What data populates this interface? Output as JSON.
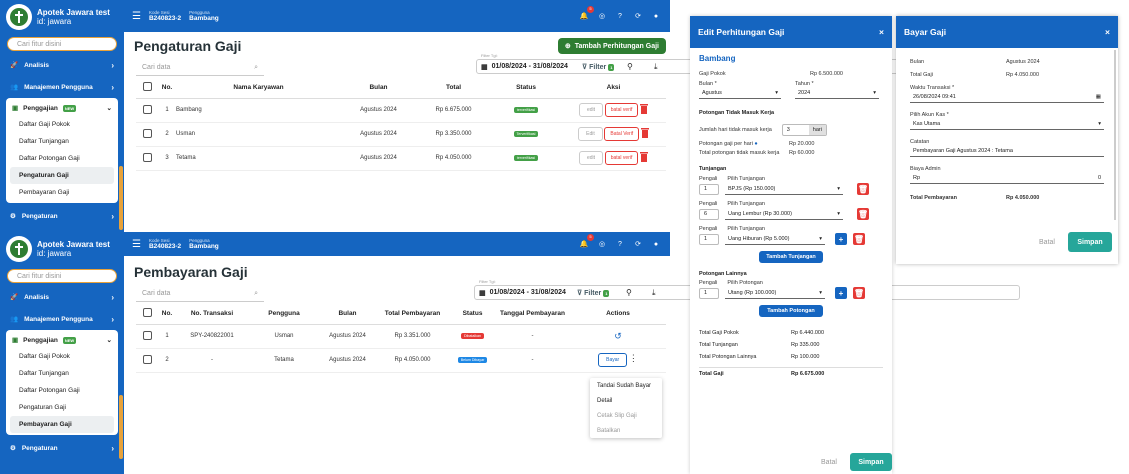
{
  "brand": {
    "name": "Apotek Jawara test",
    "id": "id: jawara"
  },
  "search_placeholder": "Cari fitur disini",
  "nav": {
    "analysis": "Analisis",
    "user_mgmt": "Manajemen Pengguna",
    "payroll": "Penggajian",
    "new_badge": "NEW",
    "settings": "Pengaturan",
    "sub": [
      "Daftar Gaji Pokok",
      "Daftar Tunjangan",
      "Daftar Potongan Gaji",
      "Pengaturan Gaji",
      "Pembayaran Gaji"
    ]
  },
  "session": {
    "code_label": "Kode Sesi",
    "code": "B240823-2",
    "user_label": "Pengguna",
    "user": "Bambang"
  },
  "notif_count": "5",
  "top": {
    "title": "Pengaturan Gaji",
    "add_button": "Tambah Perhitungan Gaji",
    "search_placeholder": "Cari data",
    "filter_label": "Filter Tgl:",
    "date_range": "01/08/2024 - 31/08/2024",
    "filter": "Filter",
    "filter_count": "1",
    "headers": [
      "No.",
      "Nama Karyawan",
      "Bulan",
      "Total",
      "Status",
      "Aksi"
    ],
    "rows": [
      {
        "no": "1",
        "name": "Bambang",
        "month": "Agustus 2024",
        "total": "Rp 6.675.000",
        "status": "terverifikasi",
        "edit": "edit",
        "verify": "batal verif"
      },
      {
        "no": "2",
        "name": "Usman",
        "month": "Agustus 2024",
        "total": "Rp 3.350.000",
        "status": "Terverifikasi",
        "edit": "Edit",
        "verify": "Batal Verif"
      },
      {
        "no": "3",
        "name": "Tetama",
        "month": "Agustus 2024",
        "total": "Rp 4.050.000",
        "status": "terverifikasi",
        "edit": "edit",
        "verify": "batal verif"
      }
    ]
  },
  "bottom": {
    "title": "Pembayaran Gaji",
    "search_placeholder": "Cari data",
    "filter_label": "Filter Tgl:",
    "date_range": "01/08/2024 - 31/08/2024",
    "filter": "Filter",
    "filter_count": "1",
    "headers": [
      "No.",
      "No. Transaksi",
      "Pengguna",
      "Bulan",
      "Total Pembayaran",
      "Status",
      "Tanggal Pembayaran",
      "Actions"
    ],
    "rows": [
      {
        "no": "1",
        "trx": "SPY-240822001",
        "user": "Usman",
        "month": "Agustus 2024",
        "total": "Rp 3.351.000",
        "status": "Dibatalkan",
        "date": "-"
      },
      {
        "no": "2",
        "trx": "-",
        "user": "Tetama",
        "month": "Agustus 2024",
        "total": "Rp 4.050.000",
        "status": "Belum Dibayar",
        "date": "-",
        "action": "Bayar"
      }
    ],
    "menu": [
      "Tandai Sudah Bayar",
      "Detail",
      "Cetak Slip Gaji",
      "Batalkan"
    ]
  },
  "edit_modal": {
    "title": "Edit Perhitungan Gaji",
    "employee": "Bambang",
    "base_label": "Gaji Pokok",
    "base_value": "Rp 6.500.000",
    "month_label": "Bulan *",
    "month": "Agustus",
    "year_label": "Tahun *",
    "year": "2024",
    "absence_section": "Potongan Tidak Masuk Kerja",
    "absent_days_label": "Jumlah hari tidak masuk kerja",
    "absent_days": "3",
    "days_unit": "hari",
    "daily_cut_label": "Potongan gaji per hari",
    "daily_cut": "Rp 20.000",
    "total_absent_label": "Total potongan tidak masuk kerja",
    "total_absent": "Rp 60.000",
    "allowance_section": "Tunjangan",
    "multiplier": "Pengali",
    "choose_allowance": "Pilih Tunjangan",
    "allowances": [
      {
        "mult": "1",
        "name": "BPJS (Rp 150.000)"
      },
      {
        "mult": "6",
        "name": "Uang Lembur (Rp 30.000)"
      },
      {
        "mult": "1",
        "name": "Uang Hiburan (Rp 5.000)"
      }
    ],
    "add_allowance": "Tambah Tunjangan",
    "other_section": "Potongan Lainnya",
    "choose_deduction": "Pilih Potongan",
    "deductions": [
      {
        "mult": "1",
        "name": "Utang (Rp 100.000)"
      }
    ],
    "add_deduction": "Tambah Potongan",
    "summary": [
      {
        "k": "Total Gaji Pokok",
        "v": "Rp 6.440.000"
      },
      {
        "k": "Total Tunjangan",
        "v": "Rp 335.000"
      },
      {
        "k": "Total Potongan Lainnya",
        "v": "Rp 100.000"
      }
    ],
    "total_label": "Total Gaji",
    "total": "Rp 6.675.000",
    "cancel": "Batal",
    "save": "Simpan"
  },
  "pay_modal": {
    "title": "Bayar Gaji",
    "month_label": "Bulan",
    "month": "Agustus 2024",
    "total_label": "Total Gaji",
    "total": "Rp 4.050.000",
    "time_label": "Waktu Transaksi *",
    "time": "26/08/2024 09:41",
    "account_label": "Pilih Akun Kas *",
    "account": "Kas Utama",
    "note_label": "Catatan",
    "note": "Pembayaran Gaji Agustus 2024 : Tetama",
    "fee_label": "Biaya Admin",
    "fee_prefix": "Rp",
    "fee": "0",
    "grand_label": "Total Pembayaran",
    "grand": "Rp 4.050.000",
    "cancel": "Batal",
    "save": "Simpan"
  },
  "colors": {
    "primary": "#1565c0",
    "green": "#2e7d32",
    "red": "#e53935",
    "teal": "#26a69a",
    "orange": "#e8a23a"
  }
}
